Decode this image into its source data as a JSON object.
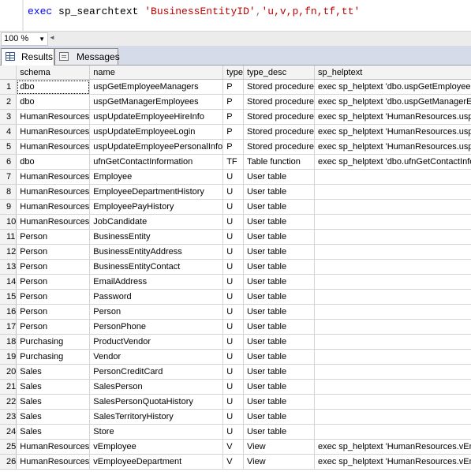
{
  "editor": {
    "tokens": [
      {
        "text": "exec",
        "cls": "kw"
      },
      {
        "text": " sp_searchtext ",
        "cls": "id"
      },
      {
        "text": "'BusinessEntityID'",
        "cls": "str"
      },
      {
        "text": ",",
        "cls": "punc"
      },
      {
        "text": "'u,v,p,fn,tf,tt'",
        "cls": "str"
      }
    ]
  },
  "zoom": {
    "value": "100 %"
  },
  "tabs": {
    "results_label": "Results",
    "messages_label": "Messages"
  },
  "columns": [
    "schema",
    "name",
    "type",
    "type_desc",
    "sp_helptext"
  ],
  "rows": [
    {
      "n": "1",
      "schema": "dbo",
      "name": "uspGetEmployeeManagers",
      "type": "P",
      "type_desc": "Stored procedure",
      "sp_helptext": "exec sp_helptext 'dbo.uspGetEmployeeManagers'"
    },
    {
      "n": "2",
      "schema": "dbo",
      "name": "uspGetManagerEmployees",
      "type": "P",
      "type_desc": "Stored procedure",
      "sp_helptext": "exec sp_helptext 'dbo.uspGetManagerEmployees'"
    },
    {
      "n": "3",
      "schema": "HumanResources",
      "name": "uspUpdateEmployeeHireInfo",
      "type": "P",
      "type_desc": "Stored procedure",
      "sp_helptext": "exec sp_helptext 'HumanResources.uspUpdateEmployeeHireInfo'"
    },
    {
      "n": "4",
      "schema": "HumanResources",
      "name": "uspUpdateEmployeeLogin",
      "type": "P",
      "type_desc": "Stored procedure",
      "sp_helptext": "exec sp_helptext 'HumanResources.uspUpdateEmployeeLogin'"
    },
    {
      "n": "5",
      "schema": "HumanResources",
      "name": "uspUpdateEmployeePersonalInfo",
      "type": "P",
      "type_desc": "Stored procedure",
      "sp_helptext": "exec sp_helptext 'HumanResources.uspUpdateEmployeePersonalInfo'"
    },
    {
      "n": "6",
      "schema": "dbo",
      "name": "ufnGetContactInformation",
      "type": "TF",
      "type_desc": "Table function",
      "sp_helptext": "exec sp_helptext 'dbo.ufnGetContactInformation'"
    },
    {
      "n": "7",
      "schema": "HumanResources",
      "name": "Employee",
      "type": "U",
      "type_desc": "User table",
      "sp_helptext": ""
    },
    {
      "n": "8",
      "schema": "HumanResources",
      "name": "EmployeeDepartmentHistory",
      "type": "U",
      "type_desc": "User table",
      "sp_helptext": ""
    },
    {
      "n": "9",
      "schema": "HumanResources",
      "name": "EmployeePayHistory",
      "type": "U",
      "type_desc": "User table",
      "sp_helptext": ""
    },
    {
      "n": "10",
      "schema": "HumanResources",
      "name": "JobCandidate",
      "type": "U",
      "type_desc": "User table",
      "sp_helptext": ""
    },
    {
      "n": "11",
      "schema": "Person",
      "name": "BusinessEntity",
      "type": "U",
      "type_desc": "User table",
      "sp_helptext": ""
    },
    {
      "n": "12",
      "schema": "Person",
      "name": "BusinessEntityAddress",
      "type": "U",
      "type_desc": "User table",
      "sp_helptext": ""
    },
    {
      "n": "13",
      "schema": "Person",
      "name": "BusinessEntityContact",
      "type": "U",
      "type_desc": "User table",
      "sp_helptext": ""
    },
    {
      "n": "14",
      "schema": "Person",
      "name": "EmailAddress",
      "type": "U",
      "type_desc": "User table",
      "sp_helptext": ""
    },
    {
      "n": "15",
      "schema": "Person",
      "name": "Password",
      "type": "U",
      "type_desc": "User table",
      "sp_helptext": ""
    },
    {
      "n": "16",
      "schema": "Person",
      "name": "Person",
      "type": "U",
      "type_desc": "User table",
      "sp_helptext": ""
    },
    {
      "n": "17",
      "schema": "Person",
      "name": "PersonPhone",
      "type": "U",
      "type_desc": "User table",
      "sp_helptext": ""
    },
    {
      "n": "18",
      "schema": "Purchasing",
      "name": "ProductVendor",
      "type": "U",
      "type_desc": "User table",
      "sp_helptext": ""
    },
    {
      "n": "19",
      "schema": "Purchasing",
      "name": "Vendor",
      "type": "U",
      "type_desc": "User table",
      "sp_helptext": ""
    },
    {
      "n": "20",
      "schema": "Sales",
      "name": "PersonCreditCard",
      "type": "U",
      "type_desc": "User table",
      "sp_helptext": ""
    },
    {
      "n": "21",
      "schema": "Sales",
      "name": "SalesPerson",
      "type": "U",
      "type_desc": "User table",
      "sp_helptext": ""
    },
    {
      "n": "22",
      "schema": "Sales",
      "name": "SalesPersonQuotaHistory",
      "type": "U",
      "type_desc": "User table",
      "sp_helptext": ""
    },
    {
      "n": "23",
      "schema": "Sales",
      "name": "SalesTerritoryHistory",
      "type": "U",
      "type_desc": "User table",
      "sp_helptext": ""
    },
    {
      "n": "24",
      "schema": "Sales",
      "name": "Store",
      "type": "U",
      "type_desc": "User table",
      "sp_helptext": ""
    },
    {
      "n": "25",
      "schema": "HumanResources",
      "name": "vEmployee",
      "type": "V",
      "type_desc": "View",
      "sp_helptext": "exec sp_helptext 'HumanResources.vEmployee'"
    },
    {
      "n": "26",
      "schema": "HumanResources",
      "name": "vEmployeeDepartment",
      "type": "V",
      "type_desc": "View",
      "sp_helptext": "exec sp_helptext 'HumanResources.vEmployeeDepartment'"
    }
  ]
}
